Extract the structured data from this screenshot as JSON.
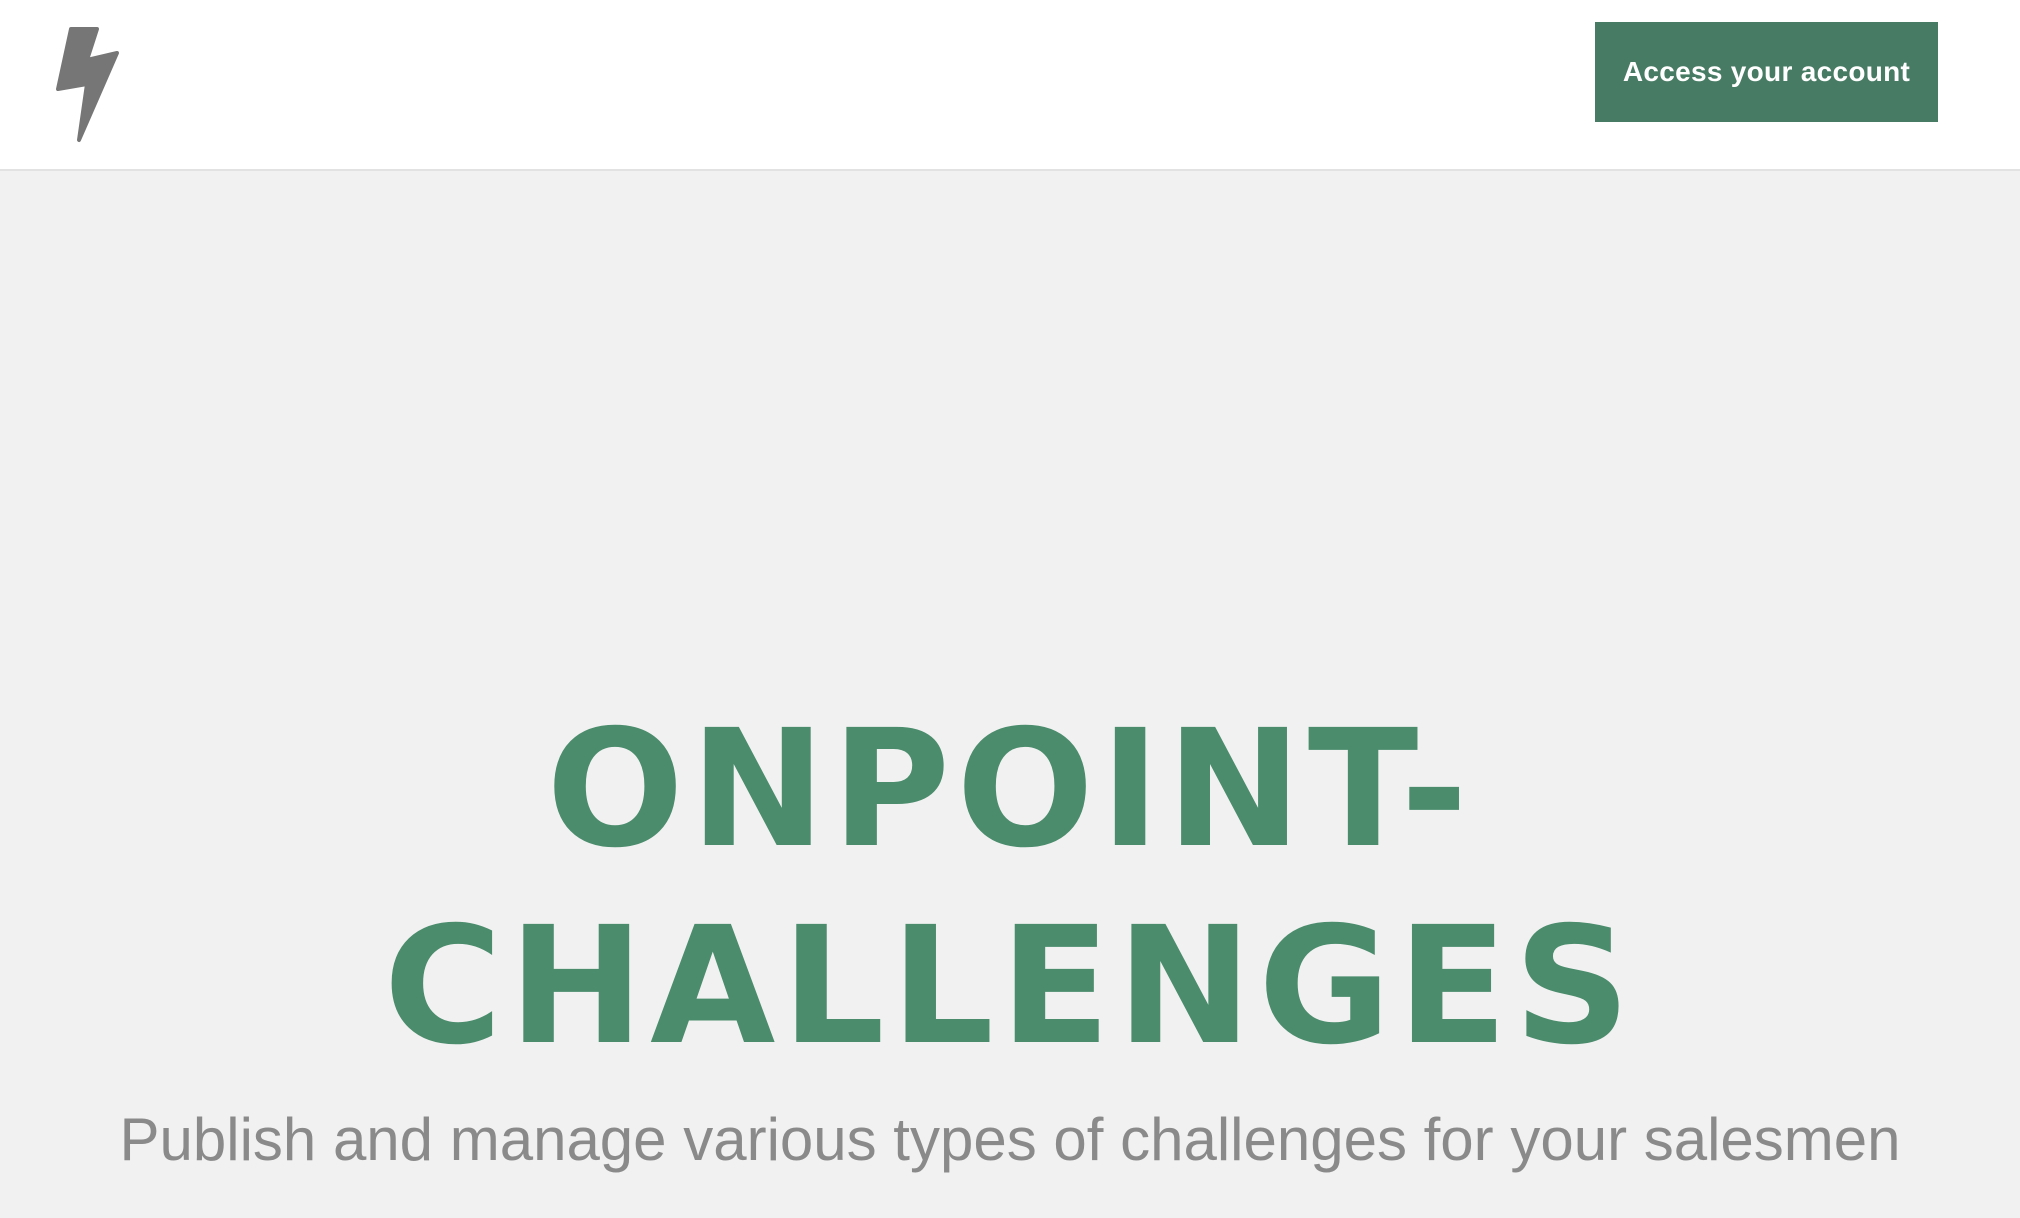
{
  "header": {
    "logo_icon": "lightning-bolt-icon",
    "access_button_label": "Access your account"
  },
  "hero": {
    "title_line1": "ONPOINT-",
    "title_line2": "CHALLENGES",
    "subtitle": "Publish and manage various types of challenges for your salesmen"
  },
  "colors": {
    "brand_green": "#477b64",
    "title_green": "#4a8c6c",
    "logo_gray": "#767676",
    "subtitle_gray": "#8a8a8a",
    "background": "#f1f1f1"
  }
}
